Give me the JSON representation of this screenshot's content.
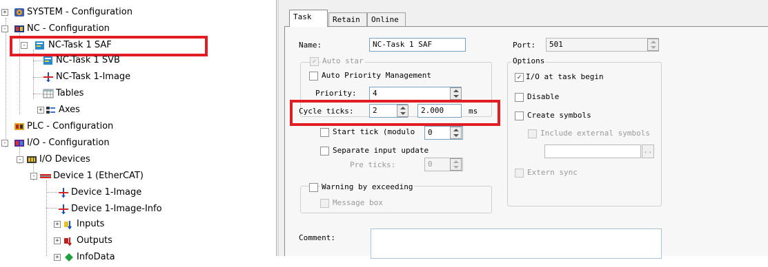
{
  "tree": {
    "items": [
      {
        "label": "SYSTEM - Configuration",
        "icon": "system-config-icon",
        "expander": "+"
      },
      {
        "label": "NC - Configuration",
        "icon": "nc-config-icon",
        "expander": "-"
      },
      {
        "label": "NC-Task 1 SAF",
        "icon": "task-icon",
        "expander": "-"
      },
      {
        "label": "NC-Task 1 SVB",
        "icon": "task-icon"
      },
      {
        "label": "NC-Task 1-Image",
        "icon": "image-icon"
      },
      {
        "label": "Tables",
        "icon": "table-icon"
      },
      {
        "label": "Axes",
        "icon": "axes-icon",
        "expander": "+"
      },
      {
        "label": "PLC - Configuration",
        "icon": "plc-config-icon"
      },
      {
        "label": "I/O - Configuration",
        "icon": "io-config-icon",
        "expander": "-"
      },
      {
        "label": "I/O Devices",
        "icon": "io-devices-icon",
        "expander": "-"
      },
      {
        "label": "Device 1 (EtherCAT)",
        "icon": "ethercat-device-icon",
        "expander": "-"
      },
      {
        "label": "Device 1-Image",
        "icon": "image-icon"
      },
      {
        "label": "Device 1-Image-Info",
        "icon": "image-icon"
      },
      {
        "label": "Inputs",
        "icon": "inputs-icon",
        "expander": "+"
      },
      {
        "label": "Outputs",
        "icon": "outputs-icon",
        "expander": "+"
      },
      {
        "label": "InfoData",
        "icon": "infodata-icon",
        "expander": "+"
      }
    ]
  },
  "tabs": [
    {
      "label": "Task",
      "active": true
    },
    {
      "label": "Retain",
      "active": false
    },
    {
      "label": "Online",
      "active": false
    }
  ],
  "form": {
    "name_label": "Name:",
    "name_value": "NC-Task 1 SAF",
    "port_label": "Port:",
    "port_value": "501",
    "auto_start_label": "Auto star",
    "auto_start_checked": true,
    "auto_priority_label": "Auto Priority Management",
    "auto_priority_checked": false,
    "priority_label": "Priority:",
    "priority_value": "4",
    "cycle_ticks_label": "Cycle ticks:",
    "cycle_ticks_value": "2",
    "cycle_time_value": "2.000",
    "cycle_unit": "ms",
    "start_tick_label": "Start tick (modulo",
    "start_tick_value": "0",
    "start_tick_checked": false,
    "separate_input_label": "Separate input update",
    "separate_input_checked": false,
    "pre_ticks_label": "Pre ticks:",
    "pre_ticks_value": "0",
    "warning_label": "Warning by exceeding",
    "warning_checked": false,
    "message_box_label": "Message box",
    "message_box_checked": false,
    "comment_label": "Comment:",
    "comment_value": ""
  },
  "options": {
    "title": "Options",
    "io_at_task_begin_label": "I/O at task begin",
    "io_at_task_begin_checked": true,
    "disable_label": "Disable",
    "disable_checked": false,
    "create_symbols_label": "Create symbols",
    "create_symbols_checked": false,
    "include_external_label": "Include external symbols",
    "include_external_checked": false,
    "browse_label": "..",
    "extern_sync_label": "Extern sync",
    "extern_sync_checked": false
  },
  "colors": {
    "highlight_box": "#e21c23"
  }
}
